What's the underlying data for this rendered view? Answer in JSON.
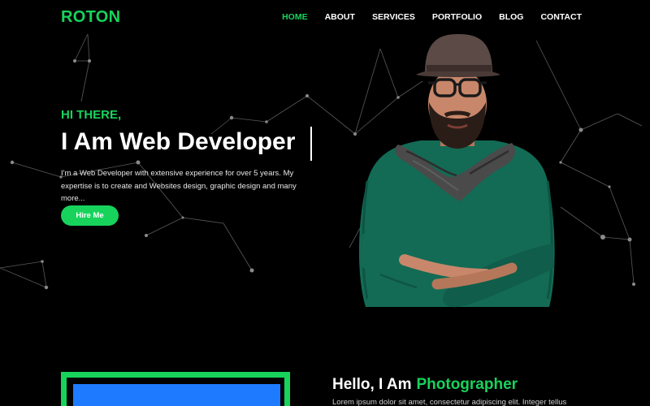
{
  "header": {
    "logo": "ROTON",
    "nav": [
      {
        "label": "HOME",
        "active": true
      },
      {
        "label": "ABOUT",
        "active": false
      },
      {
        "label": "SERVICES",
        "active": false
      },
      {
        "label": "PORTFOLIO",
        "active": false
      },
      {
        "label": "BLOG",
        "active": false
      },
      {
        "label": "CONTACT",
        "active": false
      }
    ]
  },
  "hero": {
    "greeting": "HI THERE,",
    "title": "I Am Web Developer",
    "description": "I'm a Web Developer with extensive experience for over 5 years. My expertise is to create and Websites design, graphic design and many more...",
    "button_label": "Hire Me"
  },
  "about": {
    "heading_prefix": "Hello, I Am",
    "heading_role": "Photographer",
    "text": "Lorem ipsum dolor sit amet, consectetur adipiscing elit. Integer tellus"
  },
  "colors": {
    "accent": "#17d35c",
    "background": "#000000",
    "image_placeholder": "#1e7bff",
    "sweater": "#136b55"
  },
  "icons": {
    "portrait": "developer-portrait",
    "background_pattern": "network-particles"
  }
}
